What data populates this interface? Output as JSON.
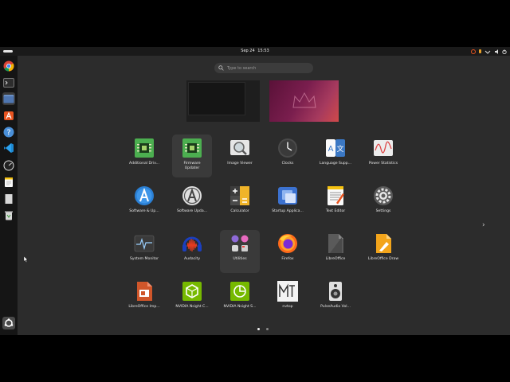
{
  "topbar": {
    "date": "Sep 24",
    "time": "15:53"
  },
  "search": {
    "placeholder": "Type to search"
  },
  "dock": {
    "items": [
      "chrome",
      "terminal",
      "files",
      "ubuntu-software",
      "help",
      "vscode",
      "system-monitor",
      "text-editor",
      "blank-document",
      "trash",
      "show-apps"
    ]
  },
  "apps": [
    {
      "label": "Additional Driv...",
      "icon": "chip-icon"
    },
    {
      "label": "Firmware Updater",
      "icon": "chip-icon"
    },
    {
      "label": "Image Viewer",
      "icon": "magnifier-icon"
    },
    {
      "label": "Clocks",
      "icon": "clock-icon"
    },
    {
      "label": "Language Supp...",
      "icon": "language-icon"
    },
    {
      "label": "Power Statistics",
      "icon": "power-stats-icon"
    },
    {
      "label": "Software & Up...",
      "icon": "software-icon"
    },
    {
      "label": "Software Upda...",
      "icon": "software-update-icon"
    },
    {
      "label": "Calculator",
      "icon": "calculator-icon"
    },
    {
      "label": "Startup Applica...",
      "icon": "startup-icon"
    },
    {
      "label": "Text Editor",
      "icon": "text-editor-icon"
    },
    {
      "label": "Settings",
      "icon": "settings-icon"
    },
    {
      "label": "System Monitor",
      "icon": "system-monitor-icon"
    },
    {
      "label": "Audacity",
      "icon": "audacity-icon"
    },
    {
      "label": "Utilities",
      "icon": "utilities-folder-icon"
    },
    {
      "label": "Firefox",
      "icon": "firefox-icon"
    },
    {
      "label": "LibreOffice",
      "icon": "libreoffice-icon"
    },
    {
      "label": "LibreOffice Draw",
      "icon": "libreoffice-draw-icon"
    },
    {
      "label": "LibreOffice Imp...",
      "icon": "libreoffice-impress-icon"
    },
    {
      "label": "NVIDIA Nsight C...",
      "icon": "nvidia-nsight-compute-icon"
    },
    {
      "label": "NVIDIA Nsight S...",
      "icon": "nvidia-nsight-systems-icon"
    },
    {
      "label": "nvtop",
      "icon": "nvtop-icon"
    },
    {
      "label": "PulseAudio Vol...",
      "icon": "speaker-icon"
    }
  ],
  "colors": {
    "background": "#2c2c2c",
    "panel": "#1a1a1a",
    "dock": "#151515",
    "accent": "#e95420"
  }
}
